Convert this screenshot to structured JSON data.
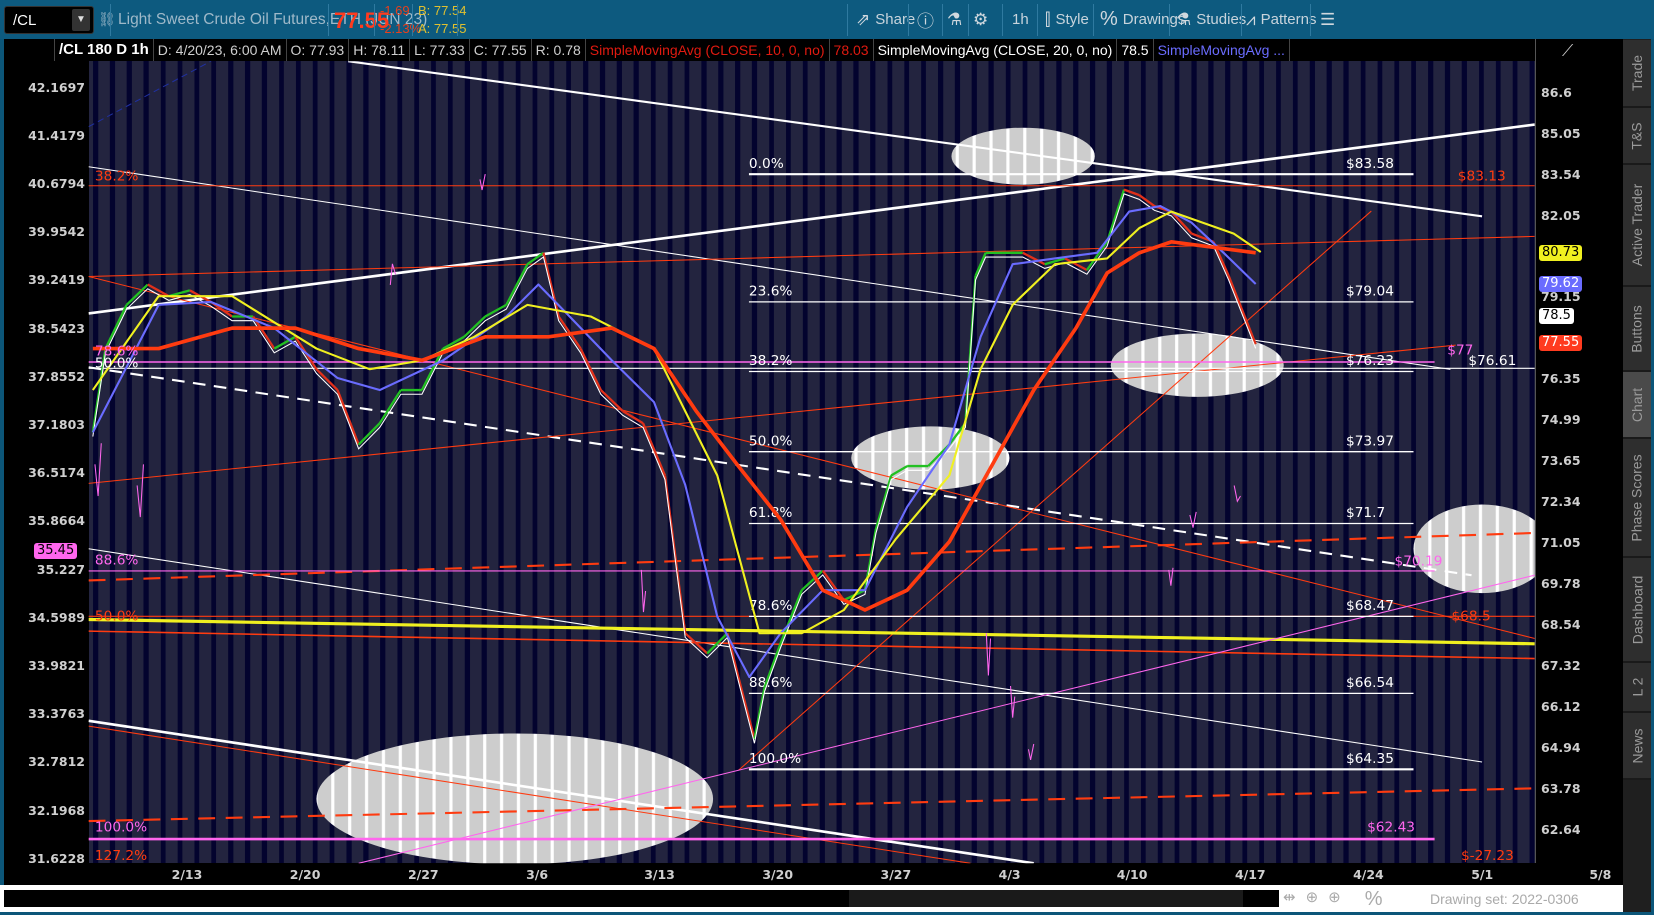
{
  "toolbar": {
    "symbol": "/CL",
    "dropdown": "▼",
    "description": "Light Sweet Crude Oil Futures,ETH (JUN 23)",
    "last": "77.55",
    "change": "-1.69",
    "change_pct": "-2.13%",
    "bid": "B: 77.54",
    "ask": "A: 77.55",
    "buttons": {
      "share": "Share",
      "timeframe": "1h",
      "style": "Style",
      "drawings": "Drawings",
      "studies": "Studies",
      "patterns": "Patterns"
    }
  },
  "header": {
    "symbol_label": "/CL 180 D 1h",
    "date": "D: 4/20/23, 6:00 AM",
    "open": "O: 77.93",
    "high": "H: 78.11",
    "low": "L: 77.33",
    "close": "C: 77.55",
    "range": "R: 0.78",
    "studies": [
      {
        "label": "SimpleMovingAvg (CLOSE, 10, 0, no)",
        "value": "78.03"
      },
      {
        "label": "SimpleMovingAvg (CLOSE, 20, 0, no)",
        "value": "78.5"
      },
      {
        "label": "SimpleMovingAvg ..."
      }
    ]
  },
  "axes": {
    "right": [
      "86.6",
      "85.05",
      "83.54",
      "82.05",
      "79.15",
      "76.35",
      "74.99",
      "73.65",
      "72.34",
      "71.05",
      "69.78",
      "68.54",
      "67.32",
      "66.12",
      "64.94",
      "63.78",
      "62.64"
    ],
    "left": [
      "42.1697",
      "41.4179",
      "40.6794",
      "39.9542",
      "39.2419",
      "38.5423",
      "37.8552",
      "37.1803",
      "36.5174",
      "35.8664",
      "35.227",
      "34.5989",
      "33.9821",
      "33.3763",
      "32.7812",
      "32.1968",
      "31.6228"
    ],
    "dates": [
      "2/13",
      "2/20",
      "2/27",
      "3/6",
      "3/13",
      "3/20",
      "3/27",
      "4/3",
      "4/10",
      "4/17",
      "4/24",
      "5/1",
      "5/8"
    ]
  },
  "badges": {
    "yellow": "80.73",
    "blue": "79.62",
    "white": "78.5",
    "last": "77.55",
    "left_pink": "35.45"
  },
  "fib": [
    {
      "pct": "0.0%",
      "price": "$83.58"
    },
    {
      "pct": "23.6%",
      "price": "$79.04"
    },
    {
      "pct": "38.2%",
      "price": "$76.23"
    },
    {
      "pct": "50.0%",
      "price": "$73.97"
    },
    {
      "pct": "61.8%",
      "price": "$71.7"
    },
    {
      "pct": "78.6%",
      "price": "$68.47"
    },
    {
      "pct": "88.6%",
      "price": "$66.54"
    },
    {
      "pct": "100.0%",
      "price": "$64.35"
    }
  ],
  "annotations": {
    "red_382": "38.2%",
    "red_8313": "$83.13",
    "pink_786": "78.6%",
    "white_500": "50.0%",
    "pink_77": "$77",
    "white_7661": "$76.61",
    "pink_886": "88.6%",
    "pink_7019": "$70.19",
    "red_500": "50.0%",
    "red_685": "$68.5",
    "pink_100": "100.0%",
    "pink_6243": "$62.43",
    "red_1272": "127.2%",
    "red_neg": "$-27.23"
  },
  "side_tabs": [
    "Trade",
    "T&S",
    "Active Trader",
    "Buttons",
    "Chart",
    "Phase Scores",
    "Dashboard",
    "L 2",
    "News"
  ],
  "footer": {
    "percent": "%",
    "drawing_set": "Drawing set: 2022-0306"
  },
  "colors": {
    "toolbar": "#0d5a7f",
    "plot_bg": "#23243f",
    "up": "#22c022",
    "down": "#e0301a",
    "sma_red": "#ff3b10",
    "sma_yellow": "#f0f020",
    "sma_blue": "#6a6cff",
    "price_red": "#ff3b1f",
    "pink": "#ff66ee"
  },
  "chart_data": {
    "type": "line",
    "x_unit": "days since 2/13",
    "y_unit": "price",
    "series": [
      {
        "name": "Close",
        "color": "#22c022",
        "points": [
          [
            -5.5,
            74.6
          ],
          [
            -4.75,
            77.4
          ],
          [
            -3.5,
            78.9
          ],
          [
            -2.25,
            79.6
          ],
          [
            -1,
            79.2
          ],
          [
            0.25,
            79.4
          ],
          [
            1.5,
            79.0
          ],
          [
            2.75,
            78.5
          ],
          [
            4,
            78.5
          ],
          [
            5.25,
            77.4
          ],
          [
            6.5,
            77.8
          ],
          [
            7.75,
            76.7
          ],
          [
            9,
            76.0
          ],
          [
            10.25,
            74.2
          ],
          [
            11.5,
            74.9
          ],
          [
            12.75,
            76.0
          ],
          [
            14,
            76.0
          ],
          [
            15.25,
            77.4
          ],
          [
            16.5,
            77.8
          ],
          [
            17.75,
            78.5
          ],
          [
            19,
            78.9
          ],
          [
            20.25,
            80.3
          ],
          [
            21.2,
            80.7
          ],
          [
            22.1,
            78.5
          ],
          [
            23.4,
            77.4
          ],
          [
            24.6,
            76.0
          ],
          [
            25.9,
            75.3
          ],
          [
            27.1,
            74.9
          ],
          [
            28.4,
            73.2
          ],
          [
            29.6,
            68.3
          ],
          [
            30.9,
            67.7
          ],
          [
            32.1,
            68.3
          ],
          [
            32.75,
            67.0
          ],
          [
            33.7,
            65.2
          ],
          [
            34.3,
            66.7
          ],
          [
            35.25,
            68.0
          ],
          [
            36.5,
            69.6
          ],
          [
            37.75,
            70.2
          ],
          [
            39,
            69.3
          ],
          [
            40.25,
            69.6
          ],
          [
            40.9,
            71.5
          ],
          [
            41.8,
            73.2
          ],
          [
            42.75,
            73.5
          ],
          [
            44,
            73.5
          ],
          [
            45.25,
            74.2
          ],
          [
            46.2,
            74.9
          ],
          [
            46.8,
            79.9
          ],
          [
            47.4,
            80.7
          ],
          [
            48.4,
            80.7
          ],
          [
            49.6,
            80.7
          ],
          [
            50.9,
            80.3
          ],
          [
            52.1,
            80.5
          ],
          [
            53.4,
            80.1
          ],
          [
            54.6,
            81.1
          ],
          [
            55.6,
            83.0
          ],
          [
            56.5,
            82.8
          ],
          [
            57.4,
            82.4
          ],
          [
            58.4,
            82.2
          ],
          [
            59.6,
            81.4
          ],
          [
            60.9,
            81.1
          ],
          [
            61.8,
            79.9
          ],
          [
            62.75,
            78.5
          ],
          [
            63.4,
            77.55
          ]
        ]
      },
      {
        "name": "SMA blue",
        "color": "#6a6cff",
        "points": [
          [
            -5.5,
            74.6
          ],
          [
            -1.6,
            78.9
          ],
          [
            1.5,
            79.0
          ],
          [
            5.25,
            78.1
          ],
          [
            9,
            76.4
          ],
          [
            11.5,
            76.0
          ],
          [
            15.25,
            77.0
          ],
          [
            19,
            78.5
          ],
          [
            20.9,
            79.6
          ],
          [
            22.75,
            78.5
          ],
          [
            25.25,
            77.0
          ],
          [
            27.75,
            75.6
          ],
          [
            29.6,
            72.9
          ],
          [
            31.5,
            68.8
          ],
          [
            33.4,
            67.0
          ],
          [
            35.25,
            68.3
          ],
          [
            37.75,
            69.6
          ],
          [
            40.25,
            69.6
          ],
          [
            42.75,
            72.2
          ],
          [
            45.25,
            74.2
          ],
          [
            47.1,
            77.8
          ],
          [
            49,
            80.3
          ],
          [
            51.5,
            80.5
          ],
          [
            54,
            80.7
          ],
          [
            55.9,
            82.2
          ],
          [
            57.75,
            82.4
          ],
          [
            59.6,
            81.8
          ],
          [
            61.5,
            80.7
          ],
          [
            63.4,
            79.62
          ]
        ]
      },
      {
        "name": "SMA yellow",
        "color": "#f0f020",
        "points": [
          [
            -5.5,
            76.0
          ],
          [
            -1.6,
            79.2
          ],
          [
            2.75,
            79.2
          ],
          [
            7.75,
            77.4
          ],
          [
            10.9,
            76.7
          ],
          [
            14,
            77.0
          ],
          [
            17.1,
            77.8
          ],
          [
            20.25,
            78.9
          ],
          [
            24,
            78.5
          ],
          [
            27.75,
            77.4
          ],
          [
            31.5,
            73.2
          ],
          [
            34,
            68.3
          ],
          [
            36.5,
            68.3
          ],
          [
            39,
            69.0
          ],
          [
            42.1,
            71.2
          ],
          [
            45.25,
            73.2
          ],
          [
            47.1,
            76.7
          ],
          [
            49,
            78.9
          ],
          [
            51.5,
            80.3
          ],
          [
            54.6,
            80.5
          ],
          [
            56.5,
            81.6
          ],
          [
            58.4,
            82.2
          ],
          [
            60.25,
            81.8
          ],
          [
            62.1,
            81.4
          ],
          [
            63.7,
            80.73
          ]
        ]
      },
      {
        "name": "SMA red",
        "color": "#ff3b10",
        "points": [
          [
            -5.5,
            77.4
          ],
          [
            -1.6,
            77.4
          ],
          [
            2.75,
            78.1
          ],
          [
            6.5,
            78.1
          ],
          [
            10.25,
            77.4
          ],
          [
            14,
            77.0
          ],
          [
            17.75,
            77.8
          ],
          [
            21.5,
            77.8
          ],
          [
            25.25,
            78.1
          ],
          [
            27.75,
            77.4
          ],
          [
            30.25,
            75.3
          ],
          [
            32.75,
            73.5
          ],
          [
            35.25,
            71.8
          ],
          [
            37.75,
            69.6
          ],
          [
            40.25,
            69.0
          ],
          [
            42.75,
            69.6
          ],
          [
            45.25,
            71.1
          ],
          [
            47.75,
            73.5
          ],
          [
            50.25,
            76.0
          ],
          [
            52.75,
            78.1
          ],
          [
            54.6,
            80.0
          ],
          [
            56.5,
            80.7
          ],
          [
            58.4,
            81.1
          ],
          [
            60.9,
            80.9
          ],
          [
            63.4,
            80.7
          ]
        ]
      }
    ]
  }
}
